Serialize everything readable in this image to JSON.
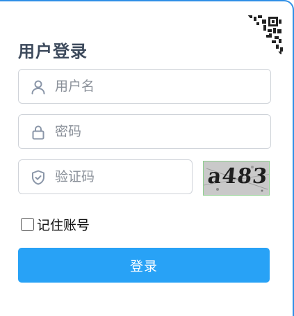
{
  "login": {
    "title": "用户登录",
    "username_placeholder": "用户名",
    "username_value": "",
    "password_placeholder": "密码",
    "password_value": "",
    "captcha_placeholder": "验证码",
    "captcha_value": "",
    "captcha_image_text": "a483",
    "remember_label": "记住账号",
    "remember_checked": false,
    "submit_label": "登录"
  },
  "icons": {
    "qr_corner": "qr-code-icon",
    "username": "user-icon",
    "password": "lock-icon",
    "captcha": "shield-check-icon"
  },
  "colors": {
    "primary": "#28a2f6",
    "title": "#3d4a5c",
    "border": "#cfd3d9",
    "placeholder": "#8a9099",
    "icon": "#8a96a8"
  }
}
